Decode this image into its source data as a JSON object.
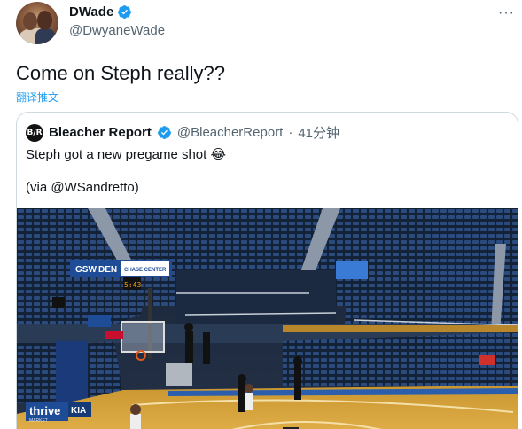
{
  "author": {
    "display_name": "DWade",
    "handle": "@DwyaneWade"
  },
  "tweet": {
    "text": "Come on Steph really??",
    "translate_label": "翻译推文"
  },
  "more_label": "···",
  "quoted": {
    "avatar_text": "B/R",
    "display_name": "Bleacher Report",
    "handle": "@BleacherReport",
    "separator": "·",
    "time": "41分钟",
    "text": "Steph got a new pregame shot 😂",
    "credit": "(via @WSandretto)"
  },
  "media": {
    "scoreboard_left": "GSW",
    "scoreboard_right": "DEN",
    "sign_chase": "CHASE CENTER",
    "clock": "5:43",
    "sponsor_thrive": "thrive",
    "sponsor_kia": "KIA",
    "sponsor_thrive_sub": "MARKET"
  },
  "colors": {
    "accent": "#1d9bf0",
    "court": "#d9a63c",
    "seats": "#1f3a66"
  }
}
